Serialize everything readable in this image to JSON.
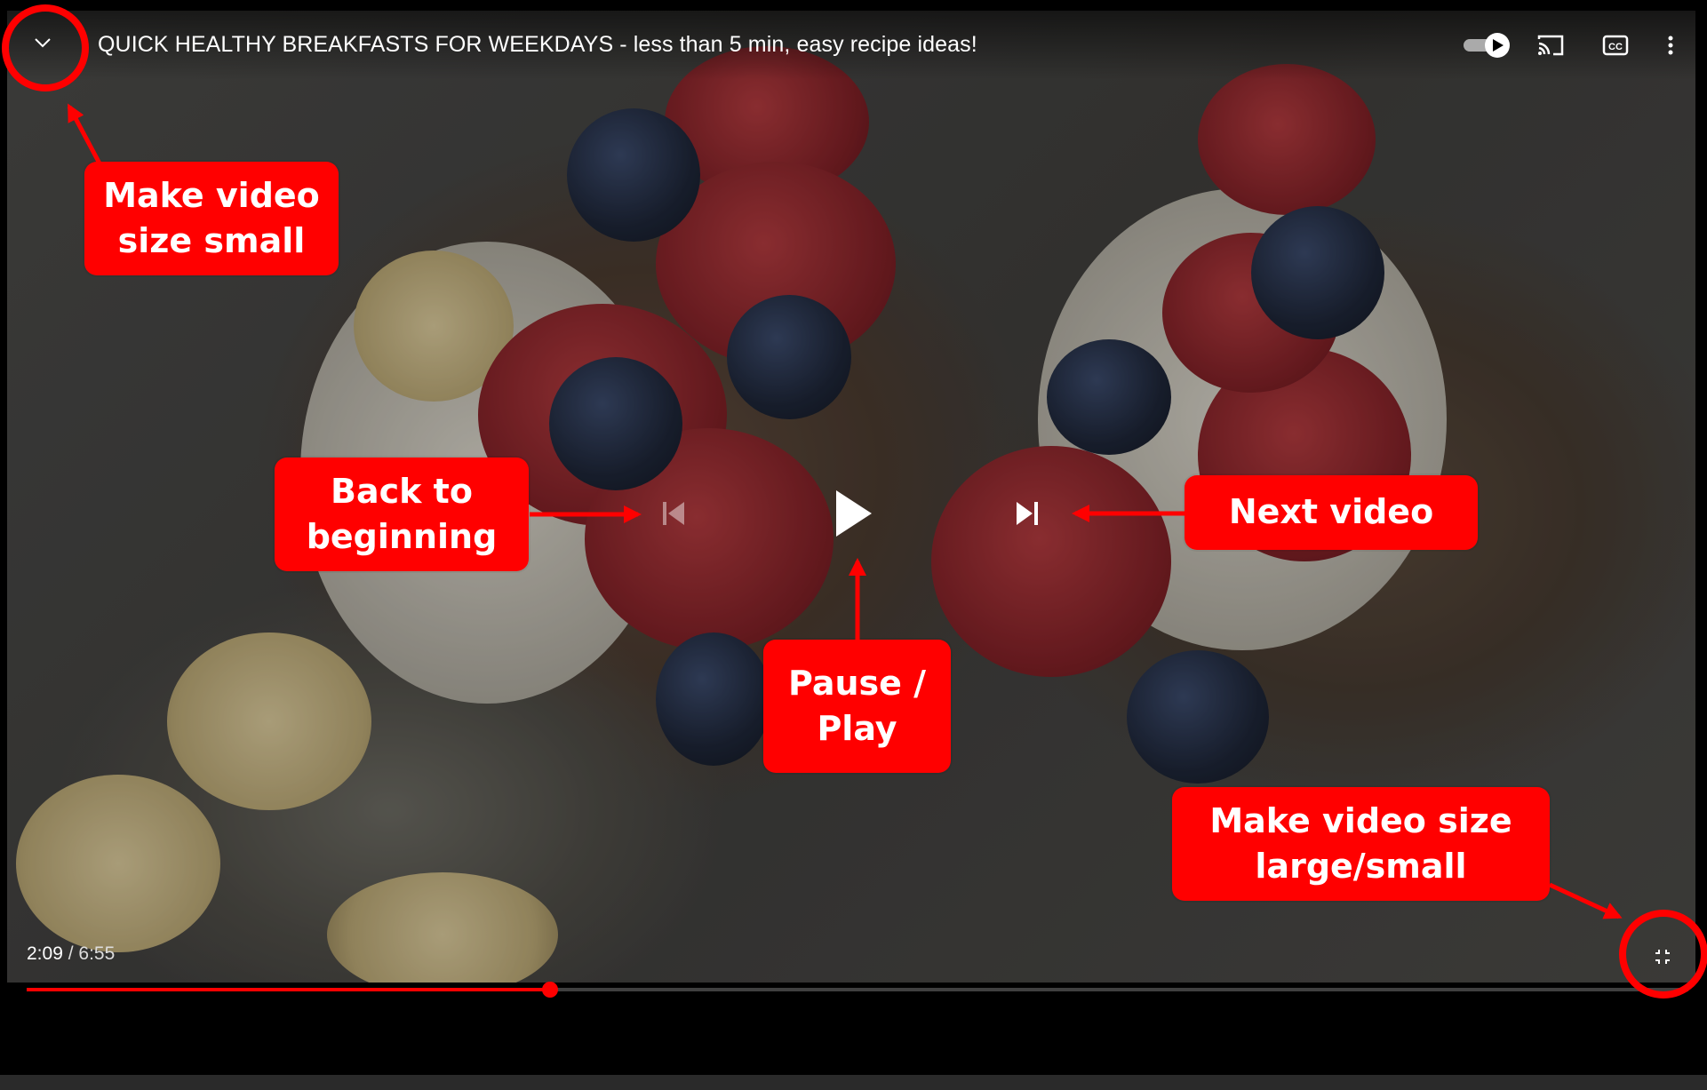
{
  "video": {
    "title": "QUICK HEALTHY BREAKFASTS FOR WEEKDAYS - less than 5 min, easy recipe ideas!",
    "current_time": "2:09",
    "time_separator": " / ",
    "duration": "6:55",
    "played_fraction": 0.315,
    "buffered_fraction": 0.3
  },
  "controls": {
    "minimize": "chevron-down-icon",
    "autoplay": "autoplay-toggle",
    "cast": "cast-icon",
    "captions": "cc-icon",
    "captions_label": "CC",
    "more": "more-vert-icon",
    "previous": "skip-previous-icon",
    "play": "play-icon",
    "next": "skip-next-icon",
    "fullscreen": "exit-fullscreen-icon"
  },
  "annotations": {
    "make_small": "Make video\nsize small",
    "back_to_beginning": "Back to\nbeginning",
    "next_video": "Next video",
    "pause_play": "Pause /\nPlay",
    "make_large_small": "Make video size\nlarge/small"
  },
  "colors": {
    "annotation": "#ff0000",
    "progress_played": "#ff0000"
  }
}
